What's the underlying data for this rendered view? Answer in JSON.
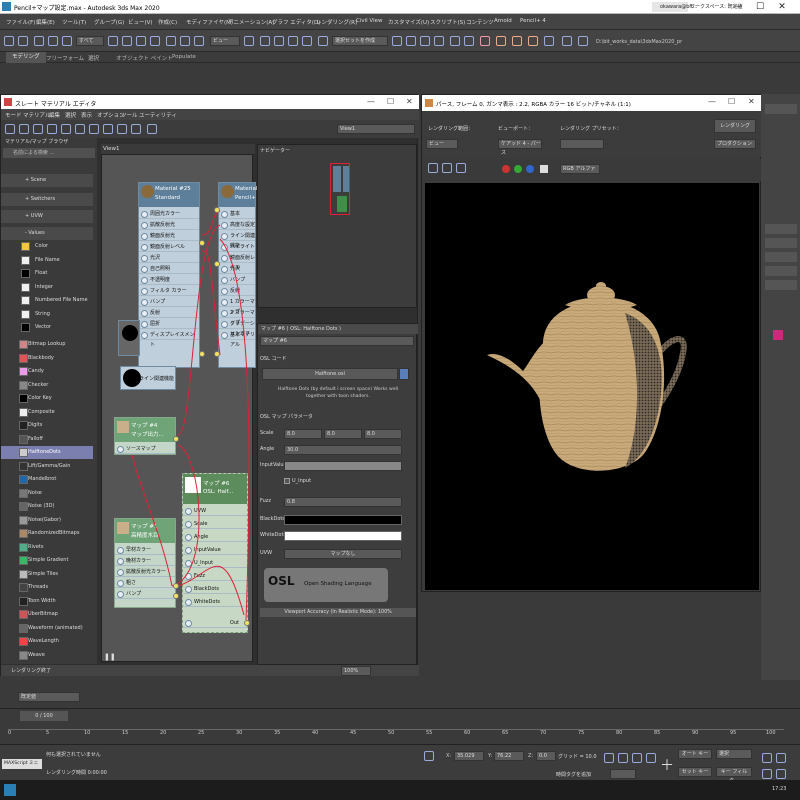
{
  "app": {
    "window_title": "Pencil+マップ設定.max - Autodesk 3ds Max 2020",
    "user": "okawara@bit...",
    "workspace": "ワークスペース: 既定値"
  },
  "menu": [
    "ファイル(F)",
    "編集(E)",
    "ツール(T)",
    "グループ(G)",
    "ビュー(V)",
    "作成(C)",
    "モディファイヤ(M)",
    "アニメーション(A)",
    "グラフ エディタ(D)",
    "レンダリング(R)",
    "Civil View",
    "カスタマイズ(U)",
    "スクリプト(S)",
    "コンテンツ",
    "Arnold",
    "Pencil+ 4"
  ],
  "toolbar": {
    "selection_filter": "すべて",
    "view_dropdown": "ビュー",
    "selection_set": "選択セットを作成",
    "project_path": "D:\\bit_works_data\\3dsMax2020_pr"
  },
  "ribbon": {
    "tabs": [
      "モデリング",
      "フリーフォーム",
      "選択",
      "オブジェクト ペイント",
      "Populate"
    ]
  },
  "slate": {
    "title": "スレート マテリアル エディタ",
    "menu": [
      "モード",
      "マテリアル",
      "編集",
      "選択",
      "表示",
      "オプション",
      "ツール",
      "ユーティリティ"
    ],
    "view_dropdown": "View1",
    "browser_title": "マテリアル/マップ ブラウザ",
    "search_placeholder": "名前による検索 ...",
    "categories": [
      "+ Scene",
      "+ Switchers",
      "+ UVW",
      "- Values"
    ],
    "values_items": [
      "Color",
      "File Name",
      "Float",
      "Integer",
      "Numbered File Name",
      "String",
      "Vector"
    ],
    "maps": [
      "Bitmap Lookup",
      "Blackbody",
      "Candy",
      "Checker",
      "Color Key",
      "Composite",
      "Digits",
      "Falloff",
      "HalftoneDots",
      "Lift/Gamma/Gain",
      "Mandelbrot",
      "Noise",
      "Noise (3D)",
      "Noise(Gabor)",
      "RandomizedBitmaps",
      "Rivets",
      "Simple Gradient",
      "Simple Tiles",
      "Threads",
      "Toon Width",
      "UberBitmap",
      "Waveform (animated)",
      "WaveLength",
      "Weave"
    ],
    "view_tab": "View1",
    "navigator_title": "ナビゲーター",
    "zoom": "100%"
  },
  "nodes": {
    "material25": {
      "title1": "Material #25",
      "title2": "Standard",
      "ports": [
        "周囲光カラー",
        "拡散反射光",
        "鏡面反射光",
        "鏡面反射レベル",
        "光沢",
        "自己照明",
        "不透明度",
        "フィルタ カラー",
        "バンプ",
        "反射",
        "屈折",
        "ディスプレイスメント"
      ]
    },
    "material_pencil": {
      "title1": "Material",
      "title2": "Pencil+",
      "ports": [
        "基本",
        "高度な設定",
        "ライン関連機能",
        "ハイライト",
        "鏡面反射レベル",
        "光沢",
        "バンプ",
        "反射",
        "1 カラーマップ",
        "2 カラーマップ",
        "グラデーションオフ",
        "基本マテリアル"
      ]
    },
    "line_func": {
      "label": "ライン関連機能"
    },
    "map4": {
      "title1": "マップ #4",
      "title2": "マップ出力...",
      "ports": [
        "ソースマップ"
      ]
    },
    "map1": {
      "title1": "マップ #1",
      "title2": "高精度木目",
      "ports": [
        "早材カラー",
        "晩材カラー",
        "拡散反射光カラー",
        "粗さ",
        "バンプ"
      ]
    },
    "map6": {
      "title1": "マップ #6",
      "title2": "OSL: Half...",
      "ports": [
        "UVW",
        "Scale",
        "Angle",
        "InputValue",
        "U_Input",
        "Fuzz",
        "BlackDots",
        "WhiteDots",
        "Out"
      ]
    }
  },
  "params": {
    "header": "マップ #6 ( OSL: Halftone Dots )",
    "name_field": "マップ #6",
    "osl_code_label": "OSL コード",
    "osl_file": "Halftone.osl",
    "description": "Halftone Dots (by default i screen space) Works well together with toon shaders.",
    "map_params_label": "OSL マップ パラメータ",
    "scale_label": "Scale",
    "scale": [
      "8.0",
      "8.0",
      "8.0"
    ],
    "angle_label": "Angle",
    "angle": "30.0",
    "inputvalue_label": "InputValue",
    "u_input_label": "U_Input",
    "fuzz_label": "Fuzz",
    "fuzz": "0.8",
    "blackdots_label": "BlackDots",
    "whitedots_label": "WhiteDots",
    "uvw_label": "UVW",
    "uvw_button": "マップなし",
    "osl_logo_text": "Open Shading Language",
    "viewport_accuracy": "Viewport Accuracy (In Realistic Mode): 100%"
  },
  "render": {
    "title": "パース, フレーム 0, ガンマ表示 : 2.2, RGBA カラー 16 ビット/チャネル (1:1)",
    "area_label": "レンダリング範囲：",
    "area_value": "ビュー",
    "viewport_label": "ビューポート：",
    "viewport_value": "ケアッド 4 - パース",
    "preset_label": "レンダリング プリセット：",
    "render_button": "レンダリング",
    "production": "プロダクション",
    "channel": "RGB アルファ"
  },
  "timeline": {
    "slider": "0 / 100",
    "ticks": [
      "0",
      "5",
      "10",
      "15",
      "20",
      "25",
      "30",
      "35",
      "40",
      "45",
      "50",
      "55",
      "60",
      "65",
      "70",
      "75",
      "80",
      "85",
      "90",
      "95",
      "100"
    ]
  },
  "status": {
    "render_done": "レンダリング終了",
    "unselected": "何も選択されていません",
    "maxscript": "MAXScript ミニ",
    "render_time": "レンダリング時間 0:00:00",
    "x_label": "X:",
    "x_value": "35.029",
    "y_label": "Y:",
    "y_value": "76.22",
    "z_label": "Z:",
    "z_value": "0.0",
    "grid": "グリッド = 10.0",
    "add_time_tag": "時間タグを追加",
    "auto_key": "オート キー",
    "set_key": "セット キー",
    "selected": "選択",
    "key_filter": "キー フィルタ...",
    "default_value": "既定値",
    "clock": "17:23"
  }
}
